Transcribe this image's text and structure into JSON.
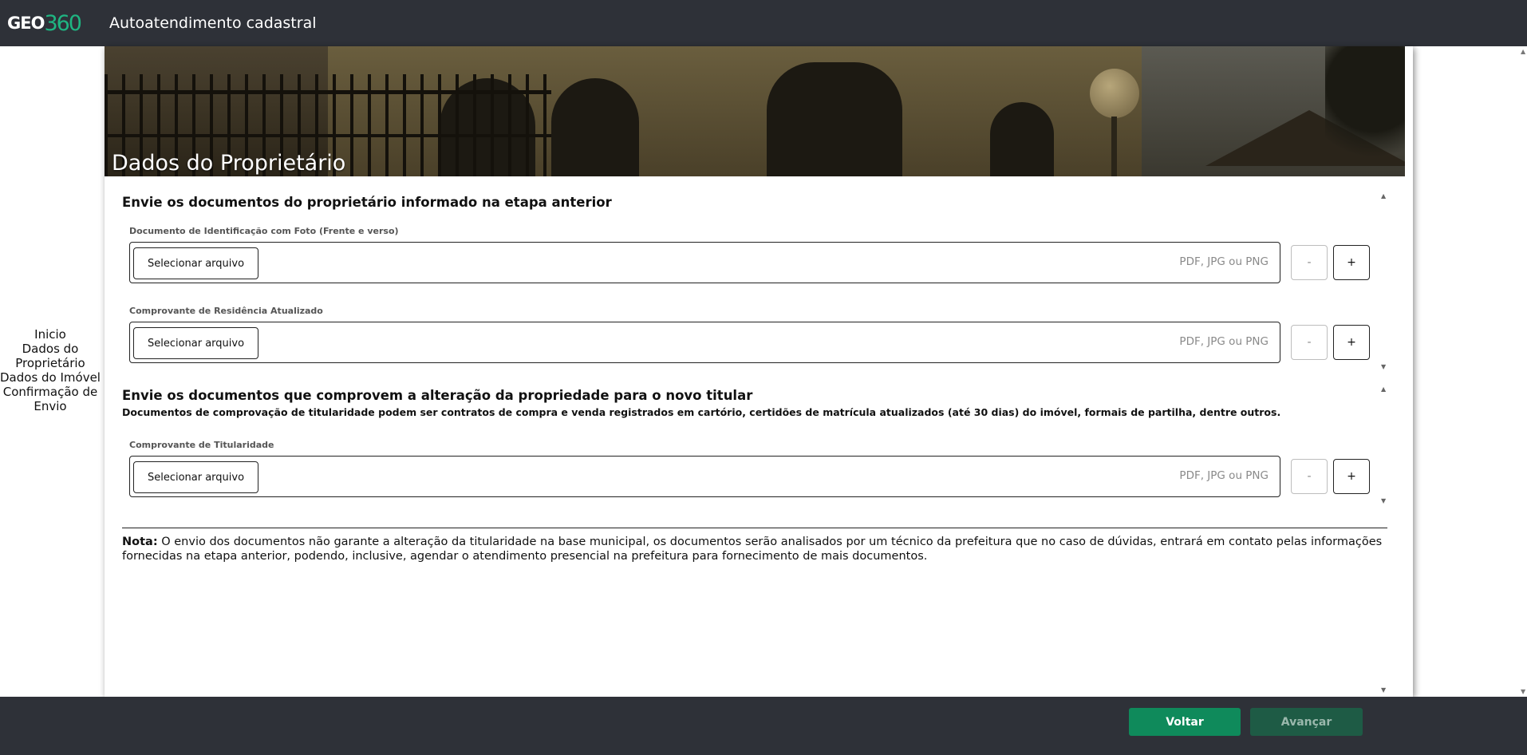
{
  "header": {
    "logo_geo": "GEO",
    "logo_num": "360",
    "title": "Autoatendimento cadastral"
  },
  "sidebar": {
    "items": [
      {
        "label": "Inicio"
      },
      {
        "label": "Dados do Proprietário"
      },
      {
        "label": "Dados do Imóvel"
      },
      {
        "label": "Confirmação de Envio"
      }
    ]
  },
  "hero": {
    "title": "Dados do Proprietário"
  },
  "section1": {
    "title": "Envie os documentos do proprietário informado na etapa anterior",
    "fields": [
      {
        "label": "Documento de Identificação com Foto (Frente e verso)",
        "button": "Selecionar arquivo",
        "hint": "PDF, JPG ou PNG",
        "minus": "-",
        "plus": "+"
      },
      {
        "label": "Comprovante de Residência Atualizado",
        "button": "Selecionar arquivo",
        "hint": "PDF, JPG ou PNG",
        "minus": "-",
        "plus": "+"
      }
    ]
  },
  "section2": {
    "title": "Envie os documentos que comprovem a alteração da propriedade para o novo titular",
    "description": "Documentos de comprovação de titularidade podem ser contratos de compra e venda registrados em cartório, certidões de matrícula atualizados (até 30 dias) do imóvel, formais de partilha, dentre outros.",
    "fields": [
      {
        "label": "Comprovante de Titularidade",
        "button": "Selecionar arquivo",
        "hint": "PDF, JPG ou PNG",
        "minus": "-",
        "plus": "+"
      }
    ]
  },
  "note": {
    "prefix": "Nota:",
    "text": " O envio dos documentos não garante a alteração da titularidade na base municipal, os documentos serão analisados por um técnico da prefeitura que no caso de dúvidas, entrará em contato pelas informações fornecidas na etapa anterior, podendo, inclusive, agendar o atendimento presencial na prefeitura para fornecimento de mais documentos."
  },
  "footer": {
    "back_label": "Voltar",
    "next_label": "Avançar"
  },
  "colors": {
    "topbar": "#2e3138",
    "accent": "#1fb582",
    "back_button": "#0f8a5b",
    "next_button_disabled": "#1e5b45"
  }
}
